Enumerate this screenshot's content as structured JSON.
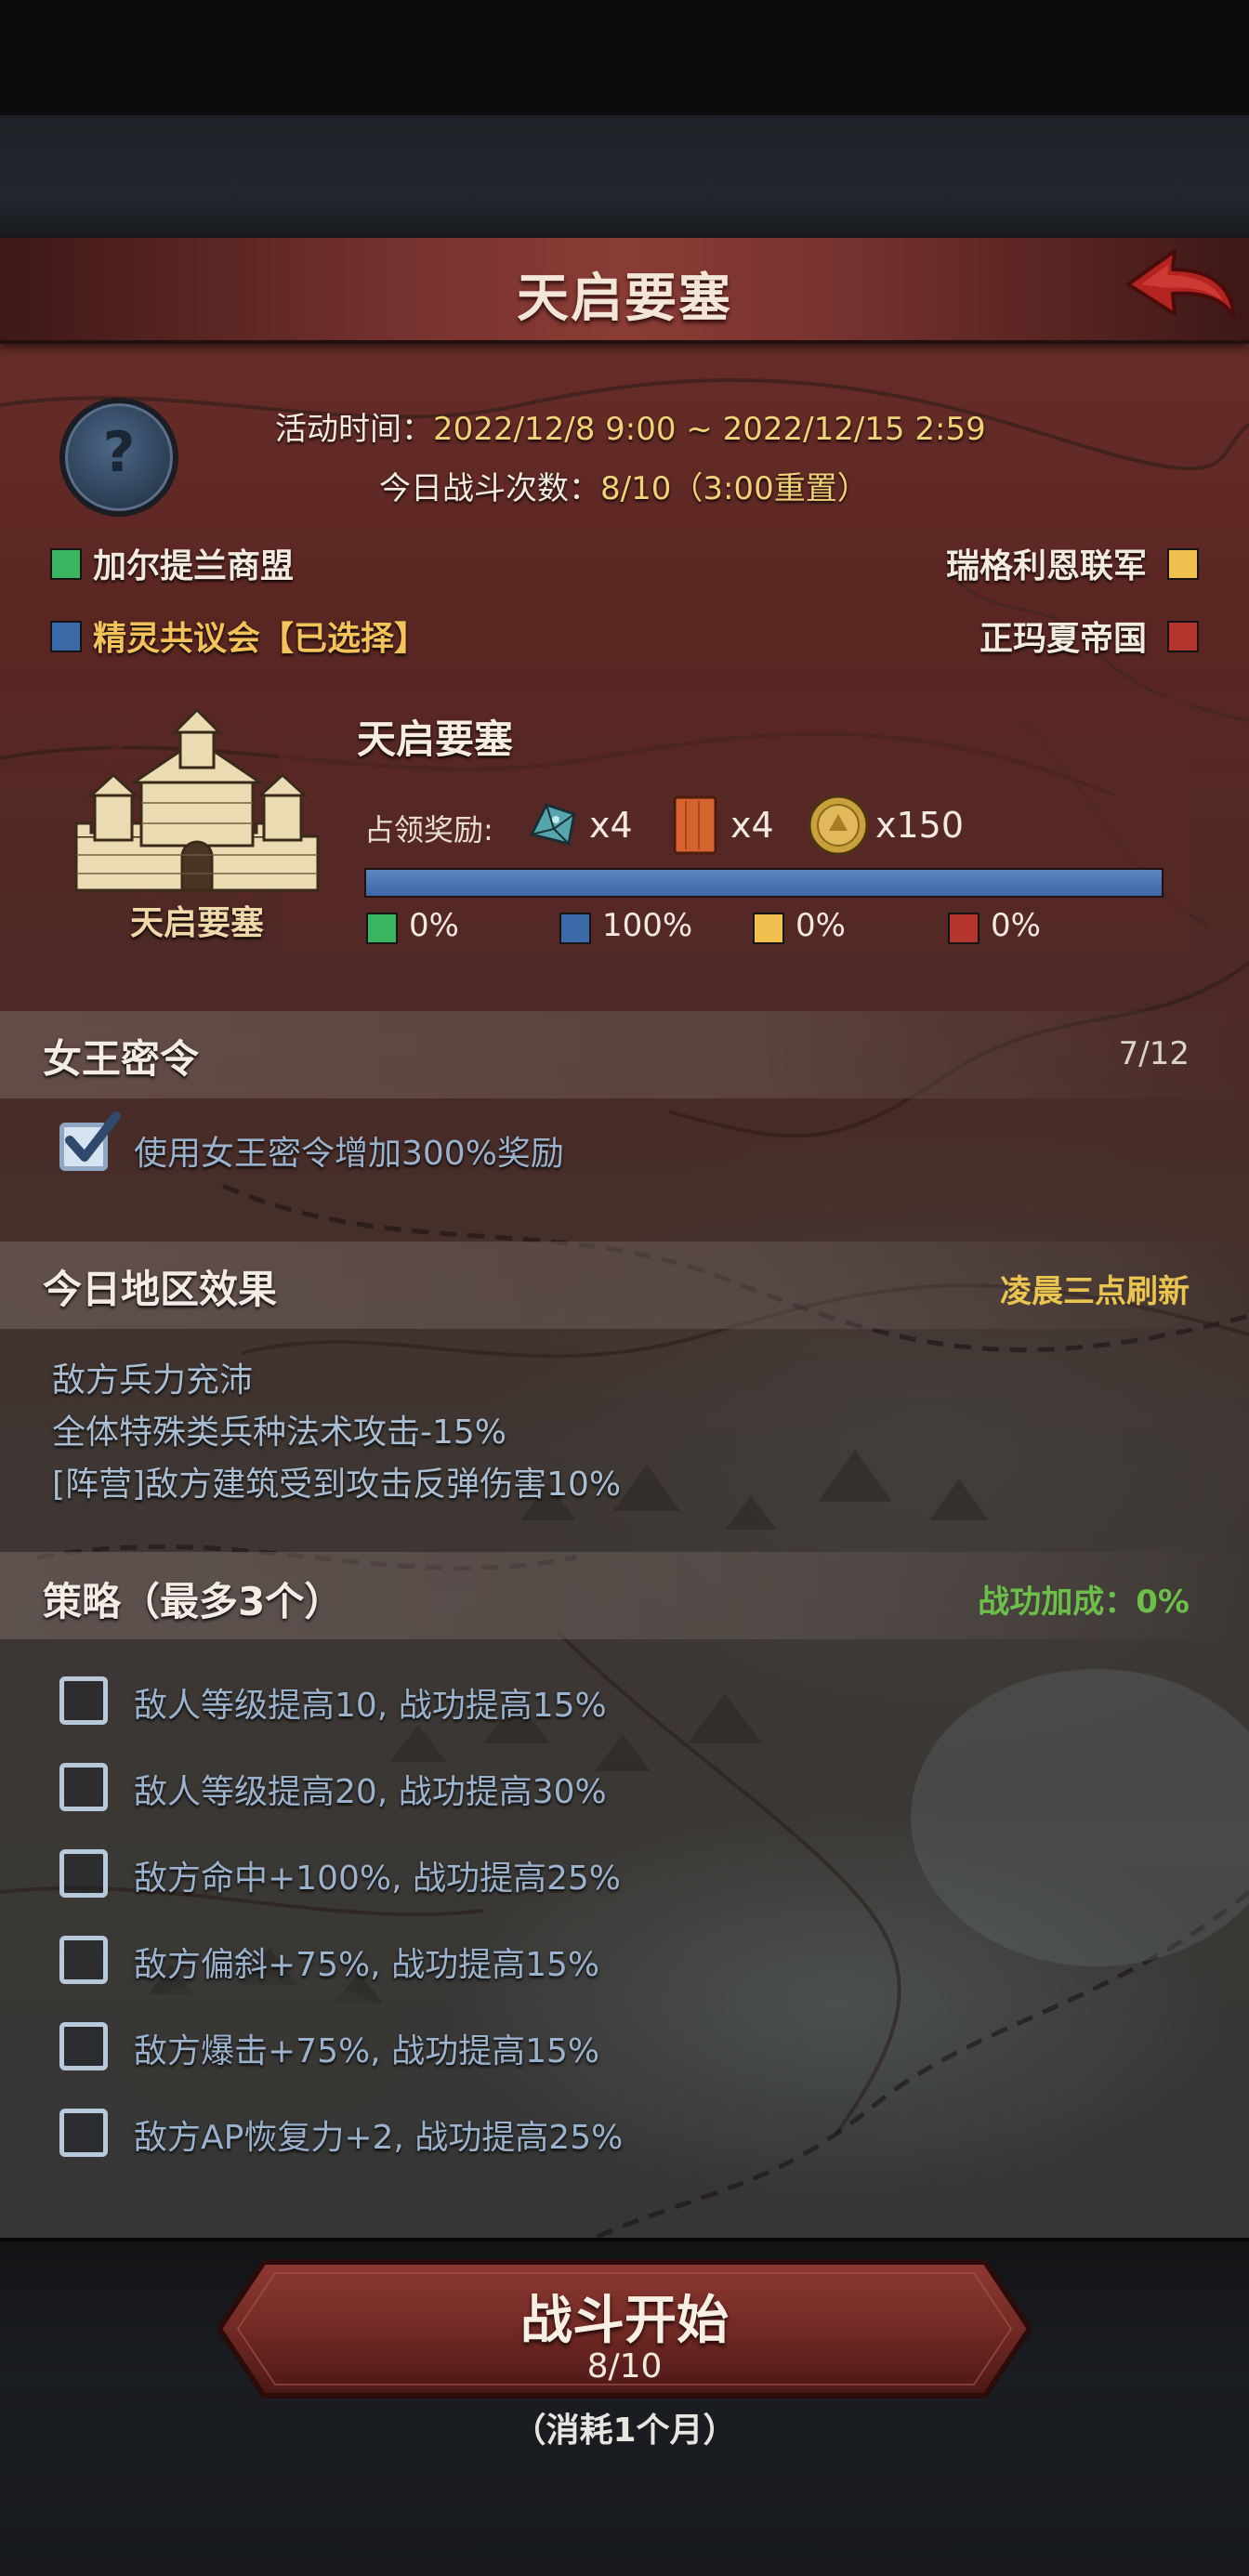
{
  "header": {
    "title": "天启要塞"
  },
  "info": {
    "activity_time_label": "活动时间：",
    "activity_time_value": "2022/12/8 9:00 ~ 2022/12/15 2:59",
    "battle_count_label": "今日战斗次数：",
    "battle_count_value": "8/10（3:00重置）"
  },
  "factions": [
    {
      "name": "加尔提兰商盟",
      "color": "#3cb563"
    },
    {
      "name": "精灵共议会【已选择】",
      "color": "#3c6aa8",
      "selected": true
    },
    {
      "name": "瑞格利恩联军",
      "color": "#f2c04e"
    },
    {
      "name": "正玛夏帝国",
      "color": "#b3352d"
    }
  ],
  "fortress": {
    "icon_label": "天启要塞",
    "title": "天启要塞",
    "reward_label": "占领奖励:",
    "rewards": [
      {
        "icon": "blue-crystal-icon",
        "count": "x4"
      },
      {
        "icon": "wood-plank-icon",
        "count": "x4"
      },
      {
        "icon": "gold-coin-icon",
        "count": "x150"
      }
    ],
    "progress": 1.0,
    "shares": [
      {
        "color": "#3cb563",
        "pct": "0%"
      },
      {
        "color": "#3c6aa8",
        "pct": "100%"
      },
      {
        "color": "#f2c04e",
        "pct": "0%"
      },
      {
        "color": "#b3352d",
        "pct": "0%"
      }
    ]
  },
  "queen": {
    "title": "女王密令",
    "count": "7/12",
    "option_label": "使用女王密令增加300%奖励",
    "checked": true
  },
  "region": {
    "title": "今日地区效果",
    "refresh": "凌晨三点刷新",
    "effects": [
      "敌方兵力充沛",
      "全体特殊类兵种法术攻击-15%",
      "[阵营]敌方建筑受到攻击反弹伤害10%"
    ]
  },
  "strategy": {
    "title": "策略（最多3个）",
    "bonus": "战功加成：0%",
    "options": [
      "敌人等级提高10, 战功提高15%",
      "敌人等级提高20, 战功提高30%",
      "敌方命中+100%, 战功提高25%",
      "敌方偏斜+75%, 战功提高15%",
      "敌方爆击+75%, 战功提高15%",
      "敌方AP恢复力+2, 战功提高25%"
    ]
  },
  "battle": {
    "start_label": "战斗开始",
    "count": "8/10",
    "cost": "（消耗1个月）"
  }
}
